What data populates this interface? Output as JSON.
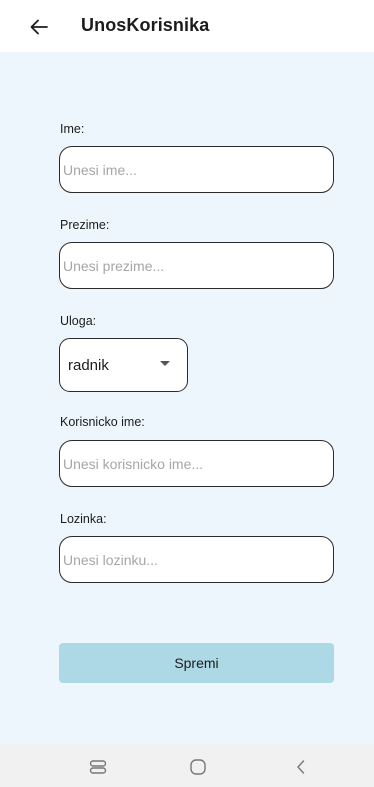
{
  "appbar": {
    "title": "UnosKorisnika",
    "back_icon": "arrow-left-icon"
  },
  "form": {
    "ime": {
      "label": "Ime:",
      "placeholder": "Unesi ime...",
      "value": ""
    },
    "prezime": {
      "label": "Prezime:",
      "placeholder": "Unesi prezime...",
      "value": ""
    },
    "uloga": {
      "label": "Uloga:",
      "selected": "radnik"
    },
    "korisnicko_ime": {
      "label": "Korisnicko ime:",
      "placeholder": "Unesi korisnicko ime...",
      "value": ""
    },
    "lozinka": {
      "label": "Lozinka:",
      "placeholder": "Unesi lozinku...",
      "value": ""
    },
    "save_label": "Spremi"
  },
  "navbar": {
    "icons": [
      "recent-apps-icon",
      "home-icon",
      "back-nav-icon"
    ]
  },
  "colors": {
    "content_bg": "#eef6fd",
    "button_bg": "#add8e6",
    "navbar_bg": "#f1f1f1"
  }
}
